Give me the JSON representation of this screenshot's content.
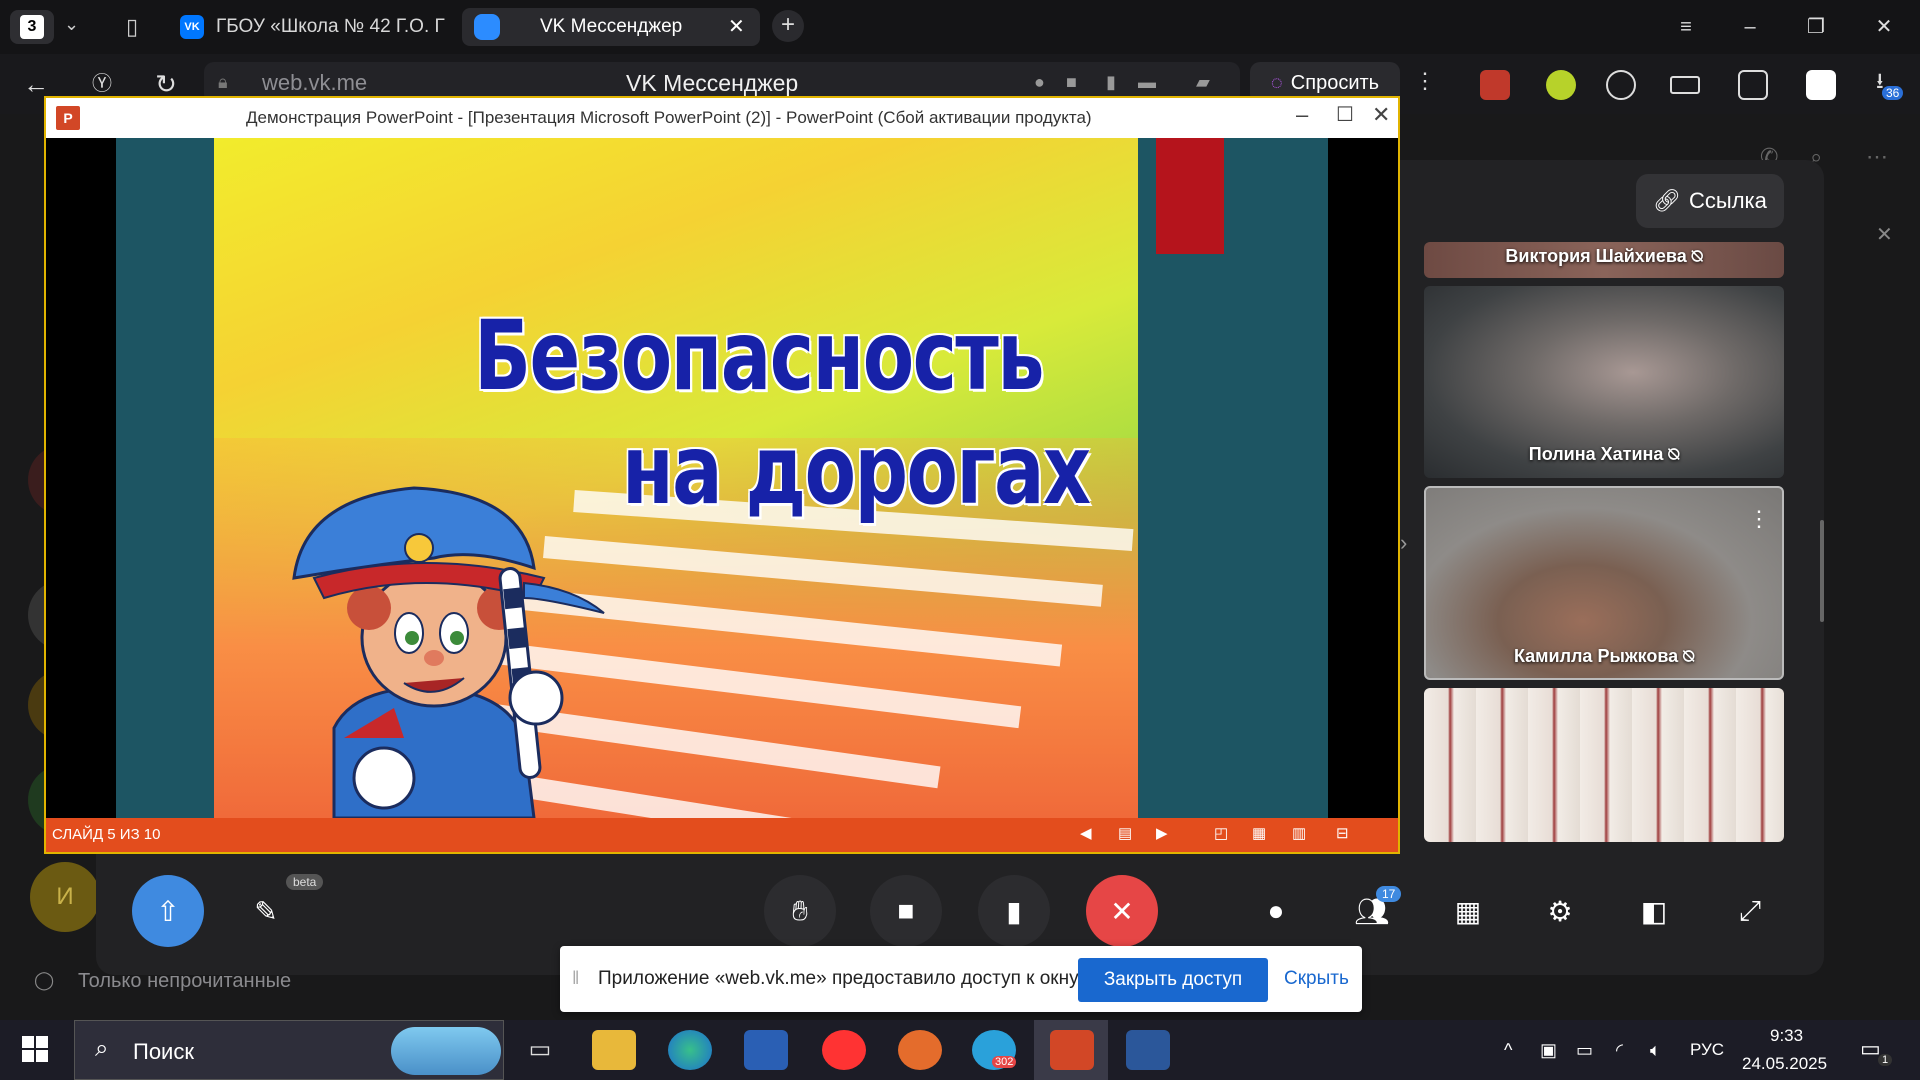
{
  "browser": {
    "tab_count": "3",
    "tabs": [
      {
        "label": "ГБОУ «Школа № 42 Г.О. Г"
      },
      {
        "label": "VK Мессенджер"
      }
    ],
    "url": "web.vk.me",
    "page_title": "VK Мессенджер",
    "ask_label": "Спросить",
    "downloads_badge": "36"
  },
  "call": {
    "link_label": "Ссылка",
    "participants": [
      {
        "name": "Виктория Шайхиева"
      },
      {
        "name": "Полина Хатина"
      },
      {
        "name": "Камилла Рыжкова"
      },
      {
        "name": ""
      }
    ],
    "participants_count": "17",
    "beta_label": "beta",
    "sidebar_avatar": "И",
    "unread_filter": "Только непрочитанные"
  },
  "powerpoint": {
    "window_title": "Демонстрация PowerPoint - [Презентация Microsoft PowerPoint (2)] - PowerPoint (Сбой активации продукта)",
    "slide_title_line1": "Безопасность",
    "slide_title_line2": "на дорогах",
    "status": "СЛАЙД 5 ИЗ 10"
  },
  "notification": {
    "text": "Приложение «web.vk.me» предоставило доступ к окну.",
    "close_access": "Закрыть доступ",
    "hide": "Скрыть"
  },
  "taskbar": {
    "search_placeholder": "Поиск",
    "telegram_badge": "302",
    "language": "РУС",
    "time": "9:33",
    "date": "24.05.2025",
    "notifications_count": "1"
  },
  "colors": {
    "ppt_accent": "#e34d1d",
    "vk_blue": "#0077ff",
    "end_call": "#e64646",
    "share_screen": "#3f8ae0",
    "close_access": "#1968cf"
  }
}
